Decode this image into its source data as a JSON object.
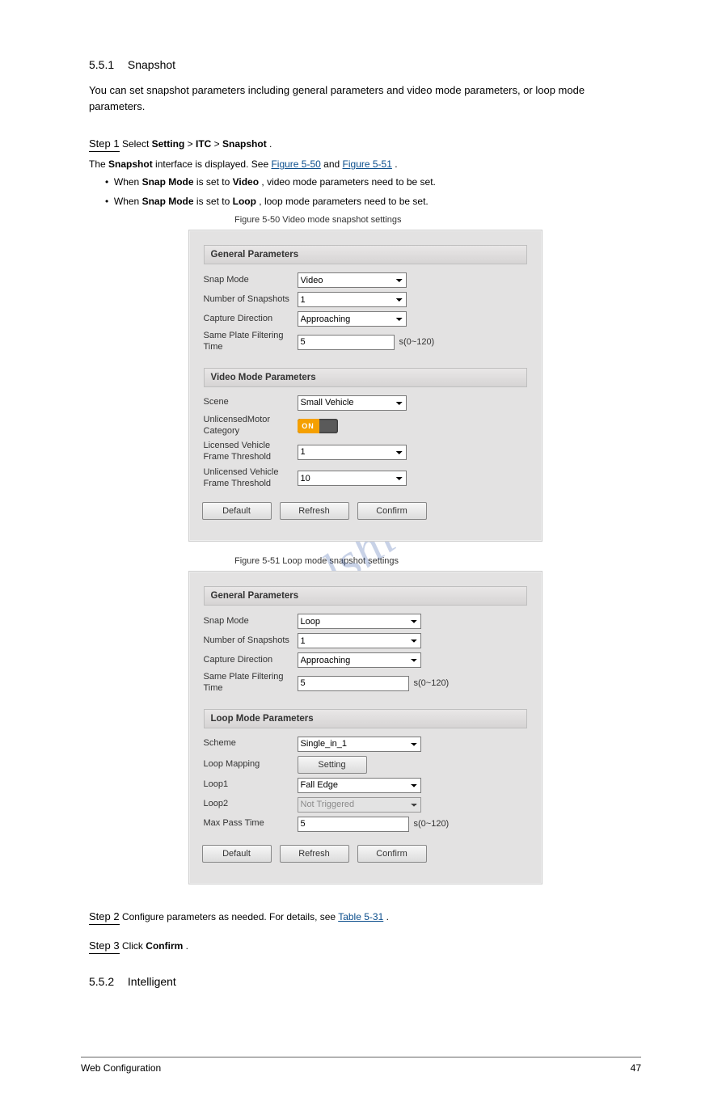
{
  "watermark": "manualshive.com",
  "sections": {
    "s551": {
      "num": "5.5.1",
      "title": "Snapshot"
    },
    "s552": {
      "num": "5.5.2",
      "title": "Intelligent"
    }
  },
  "texts": {
    "intro_551": "You can set snapshot parameters including general parameters and video mode parameters, or loop mode parameters.",
    "step1": "Step 1",
    "step1_text_a": "Select ",
    "step1_text_b": " > ",
    "step1_link1": "Setting",
    "step1_link2": "ITC",
    "step1_link3": "Snapshot",
    "step1_text_c": ".",
    "step1_text_d": "The ",
    "step1_text_e": " interface is displayed. See ",
    "fig_550": "Figure 5-50",
    "fig_550_and": " and ",
    "fig_551": "Figure 5-51",
    "fig_550_dot": ".",
    "fig_550_caption": "Figure 5-50 Video mode snapshot settings",
    "fig_551_caption": "Figure 5-51 Loop mode snapshot settings",
    "step2": "Step 2",
    "step2_text_a": "Configure parameters as needed. For details, see ",
    "table_531": "Table 5-31",
    "step2_text_b": ".",
    "bullet1_a": "When ",
    "bullet1_bold": "Snap Mode",
    "bullet1_b": " is set to ",
    "bullet1_bold2": "Video",
    "bullet1_c": ", video mode parameters need to be set.",
    "bullet2_a": "When ",
    "bullet2_bold": "Snap Mode",
    "bullet2_b": " is set to ",
    "bullet2_bold2": "Loop",
    "bullet2_c": ", loop mode parameters need to be set.",
    "step3": "Step 3",
    "step3_text_a": "Click ",
    "step3_bold": "Confirm",
    "step3_text_b": "."
  },
  "panel1": {
    "h1": "General Parameters",
    "h2": "Video Mode Parameters",
    "snap_mode_lab": "Snap Mode",
    "snap_mode_val": "Video",
    "nsnap_lab": "Number of Snapshots",
    "nsnap_val": "1",
    "capdir_lab": "Capture Direction",
    "capdir_val": "Approaching",
    "spft_lab": "Same Plate Filtering Time",
    "spft_val": "5",
    "spft_suffix": "s(0~120)",
    "scene_lab": "Scene",
    "scene_val": "Small Vehicle",
    "umc_lab": "UnlicensedMotor Category",
    "umc_on": "ON",
    "lvft_lab": "Licensed Vehicle Frame Threshold",
    "lvft_val": "1",
    "uvft_lab": "Unlicensed Vehicle Frame Threshold",
    "uvft_val": "10",
    "btn_default": "Default",
    "btn_refresh": "Refresh",
    "btn_confirm": "Confirm"
  },
  "panel2": {
    "h1": "General Parameters",
    "h2": "Loop Mode Parameters",
    "snap_mode_lab": "Snap Mode",
    "snap_mode_val": "Loop",
    "nsnap_lab": "Number of Snapshots",
    "nsnap_val": "1",
    "capdir_lab": "Capture Direction",
    "capdir_val": "Approaching",
    "spft_lab": "Same Plate Filtering Time",
    "spft_val": "5",
    "spft_suffix": "s(0~120)",
    "scheme_lab": "Scheme",
    "scheme_val": "Single_in_1",
    "lmap_lab": "Loop Mapping",
    "lmap_btn": "Setting",
    "loop1_lab": "Loop1",
    "loop1_val": "Fall Edge",
    "loop2_lab": "Loop2",
    "loop2_val": "Not Triggered",
    "mpt_lab": "Max Pass Time",
    "mpt_val": "5",
    "mpt_suffix": "s(0~120)",
    "btn_default": "Default",
    "btn_refresh": "Refresh",
    "btn_confirm": "Confirm"
  },
  "footer": {
    "title": "Web Configuration",
    "page": "47"
  }
}
